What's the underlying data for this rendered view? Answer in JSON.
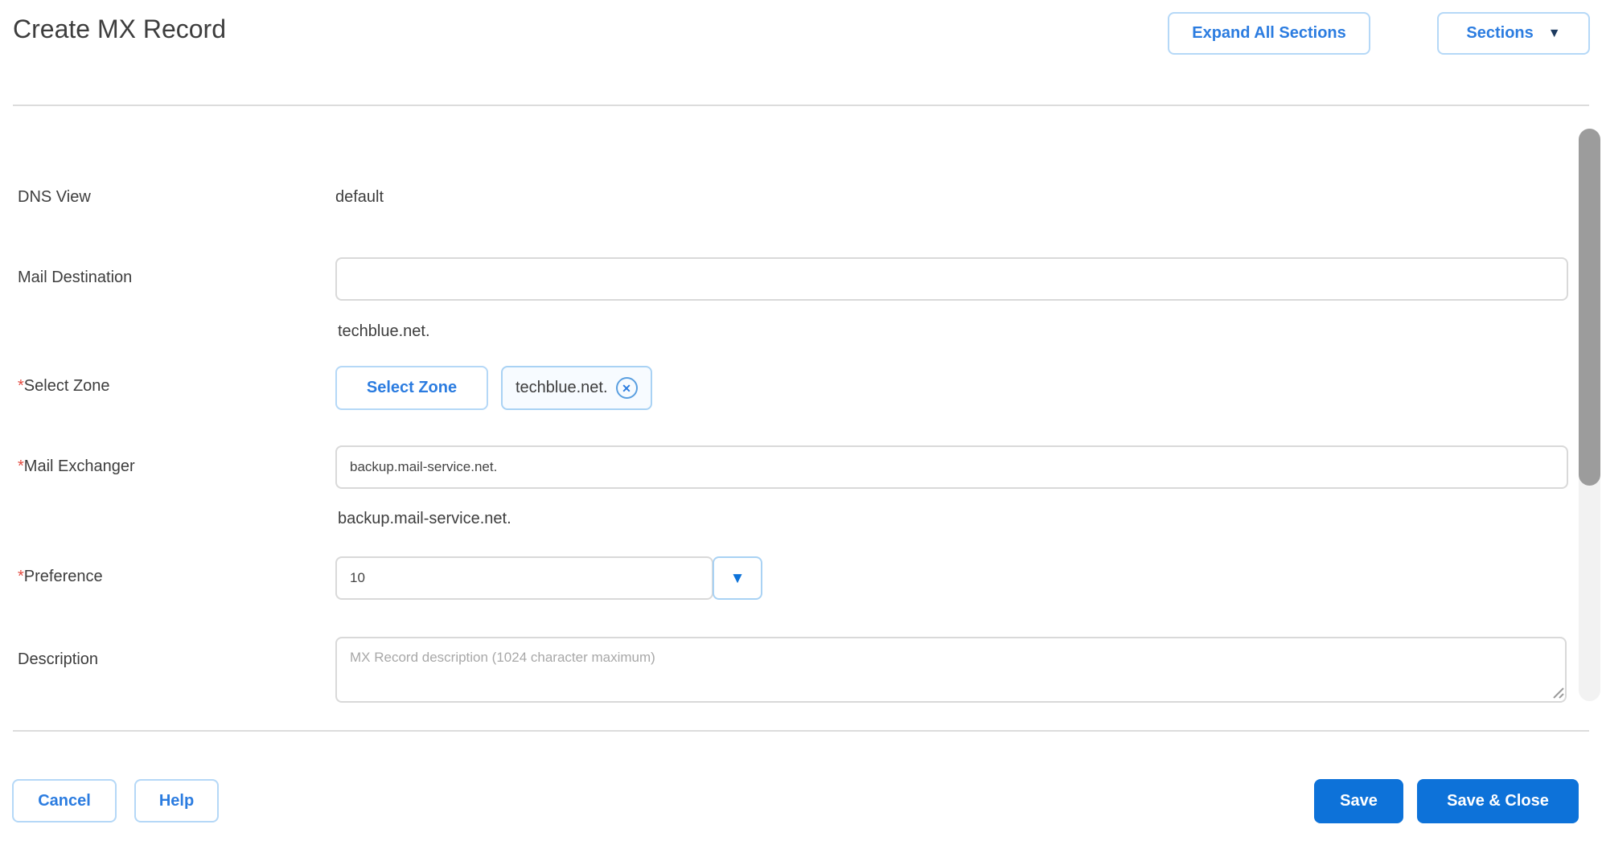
{
  "header": {
    "title": "Create MX Record",
    "expand_all_label": "Expand All Sections",
    "sections_label": "Sections",
    "sections_caret_icon": "▼"
  },
  "form": {
    "dns_view": {
      "label": "DNS View",
      "value": "default"
    },
    "mail_destination": {
      "label": "Mail Destination",
      "value": "",
      "helper": "techblue.net."
    },
    "select_zone": {
      "required_marker": "*",
      "label": "Select Zone",
      "button_label": "Select Zone",
      "chip_label": "techblue.net.",
      "chip_remove_icon": "✕"
    },
    "mail_exchanger": {
      "required_marker": "*",
      "label": "Mail Exchanger",
      "value": "backup.mail-service.net.",
      "helper": "backup.mail-service.net."
    },
    "preference": {
      "required_marker": "*",
      "label": "Preference",
      "value": "10",
      "dropdown_caret_icon": "▼"
    },
    "description": {
      "label": "Description",
      "value": "",
      "placeholder": "MX Record description (1024 character maximum)"
    }
  },
  "footer": {
    "cancel_label": "Cancel",
    "help_label": "Help",
    "save_label": "Save",
    "save_close_label": "Save & Close"
  },
  "colors": {
    "accent_blue": "#0d72d9",
    "link_blue": "#2b7ce0",
    "light_blue_border": "#a9d2f4",
    "required_red": "#e4493f",
    "label_gray": "#3d3d3d",
    "navy_caret": "#1d3a5f"
  }
}
